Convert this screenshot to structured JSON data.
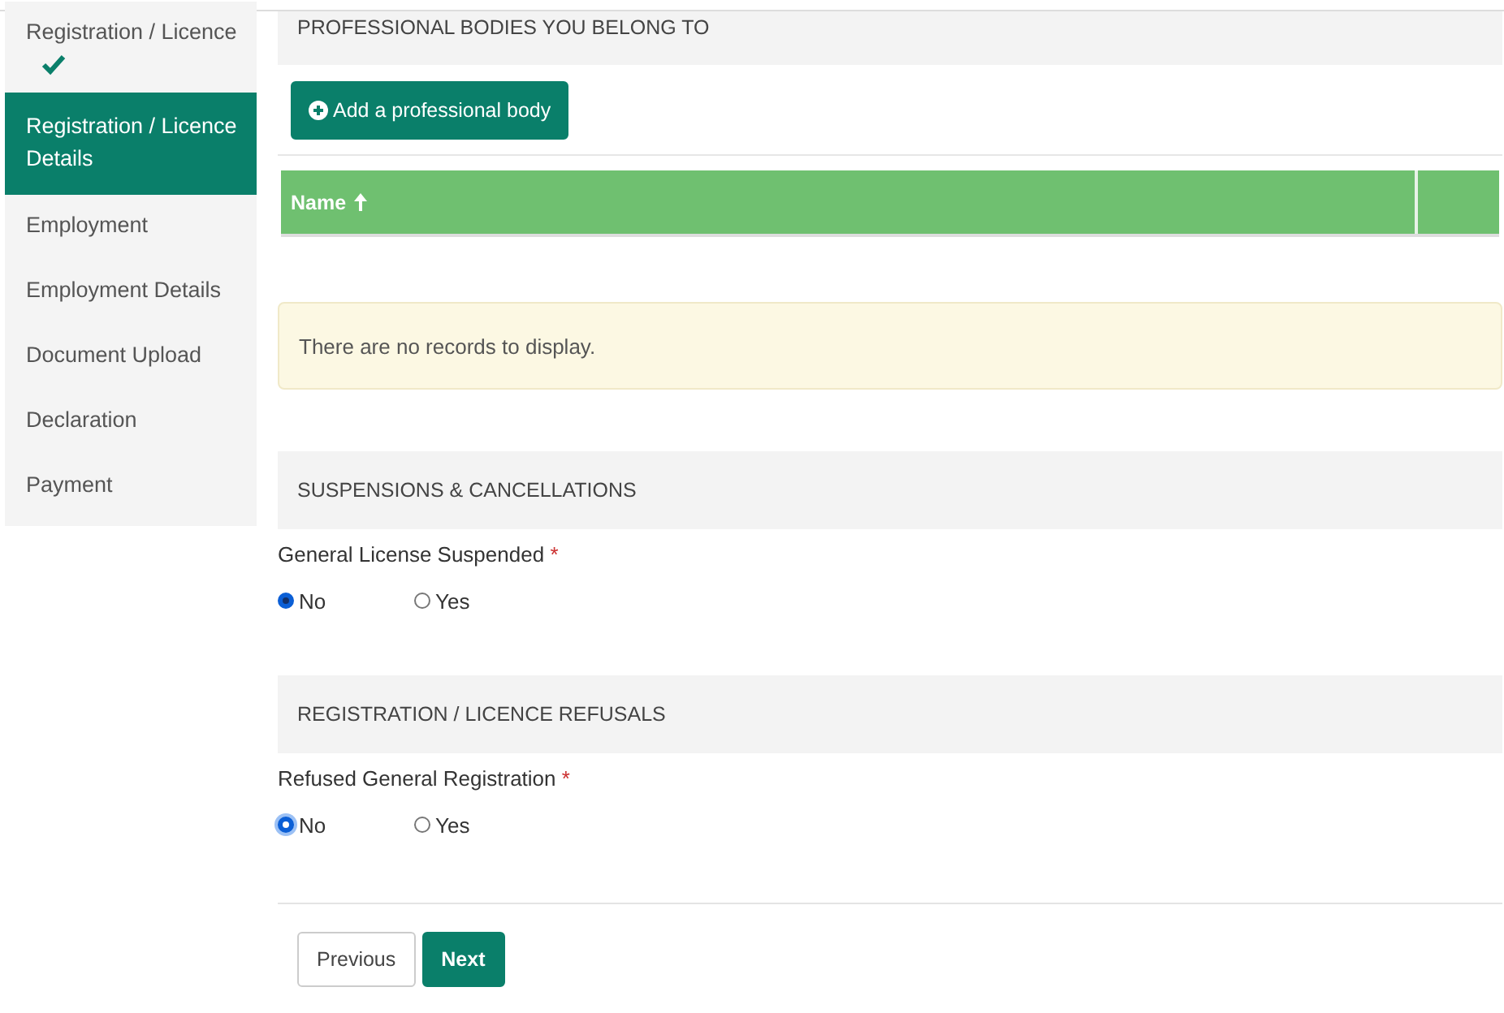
{
  "sidebar": {
    "items": [
      {
        "label": "Registration / Licence",
        "selected": false,
        "completed": true
      },
      {
        "label": "Registration / Licence Details",
        "selected": true,
        "completed": false
      },
      {
        "label": "Employment",
        "selected": false,
        "completed": false
      },
      {
        "label": "Employment Details",
        "selected": false,
        "completed": false
      },
      {
        "label": "Document Upload",
        "selected": false,
        "completed": false
      },
      {
        "label": "Declaration",
        "selected": false,
        "completed": false
      },
      {
        "label": "Payment",
        "selected": false,
        "completed": false
      }
    ]
  },
  "professional_bodies": {
    "heading": "PROFESSIONAL BODIES YOU BELONG TO",
    "add_button": "Add a professional body",
    "table": {
      "columns": [
        {
          "label": "Name",
          "sorted_ascending": true
        },
        {
          "sorted_ascending": false
        }
      ]
    },
    "empty_message": "There are no records to display."
  },
  "sections": [
    {
      "heading": "SUSPENSIONS & CANCELLATIONS",
      "question": "General License Suspended",
      "required_mark": "*",
      "options": [
        {
          "label": "No",
          "selected": true,
          "focused": false
        },
        {
          "label": "Yes",
          "selected": false,
          "focused": false
        }
      ]
    },
    {
      "heading": "REGISTRATION / LICENCE REFUSALS",
      "question": "Refused General Registration",
      "required_mark": "*",
      "options": [
        {
          "label": "No",
          "selected": true,
          "focused": true
        },
        {
          "label": "Yes",
          "selected": false,
          "focused": false
        }
      ]
    }
  ],
  "buttons": [
    {
      "label": "Previous",
      "kind": "secondary"
    },
    {
      "label": "Next",
      "kind": "primary"
    }
  ]
}
